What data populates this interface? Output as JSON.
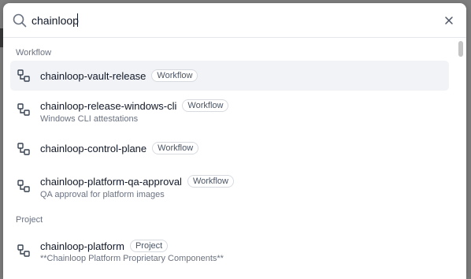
{
  "search": {
    "value": "chainloop",
    "placeholder": ""
  },
  "icons": {
    "search": "search-icon",
    "close": "close-icon",
    "workflow": "workflow-icon"
  },
  "groups": [
    {
      "heading": "Workflow",
      "items": [
        {
          "title": "chainloop-vault-release",
          "badge": "Workflow",
          "description": "",
          "selected": true
        },
        {
          "title": "chainloop-release-windows-cli",
          "badge": "Workflow",
          "description": "Windows CLI attestations",
          "selected": false
        },
        {
          "title": "chainloop-control-plane",
          "badge": "Workflow",
          "description": "",
          "selected": false
        },
        {
          "title": "chainloop-platform-qa-approval",
          "badge": "Workflow",
          "description": "QA approval for platform images",
          "selected": false
        }
      ]
    },
    {
      "heading": "Project",
      "items": [
        {
          "title": "chainloop-platform",
          "badge": "Project",
          "description": "**Chainloop Platform Proprietary Components**",
          "selected": false
        }
      ]
    }
  ],
  "colors": {
    "selected_row": "#f1f3f6",
    "overlay": "#7f7f7f",
    "text_primary": "#111827",
    "text_muted": "#6b7280"
  }
}
